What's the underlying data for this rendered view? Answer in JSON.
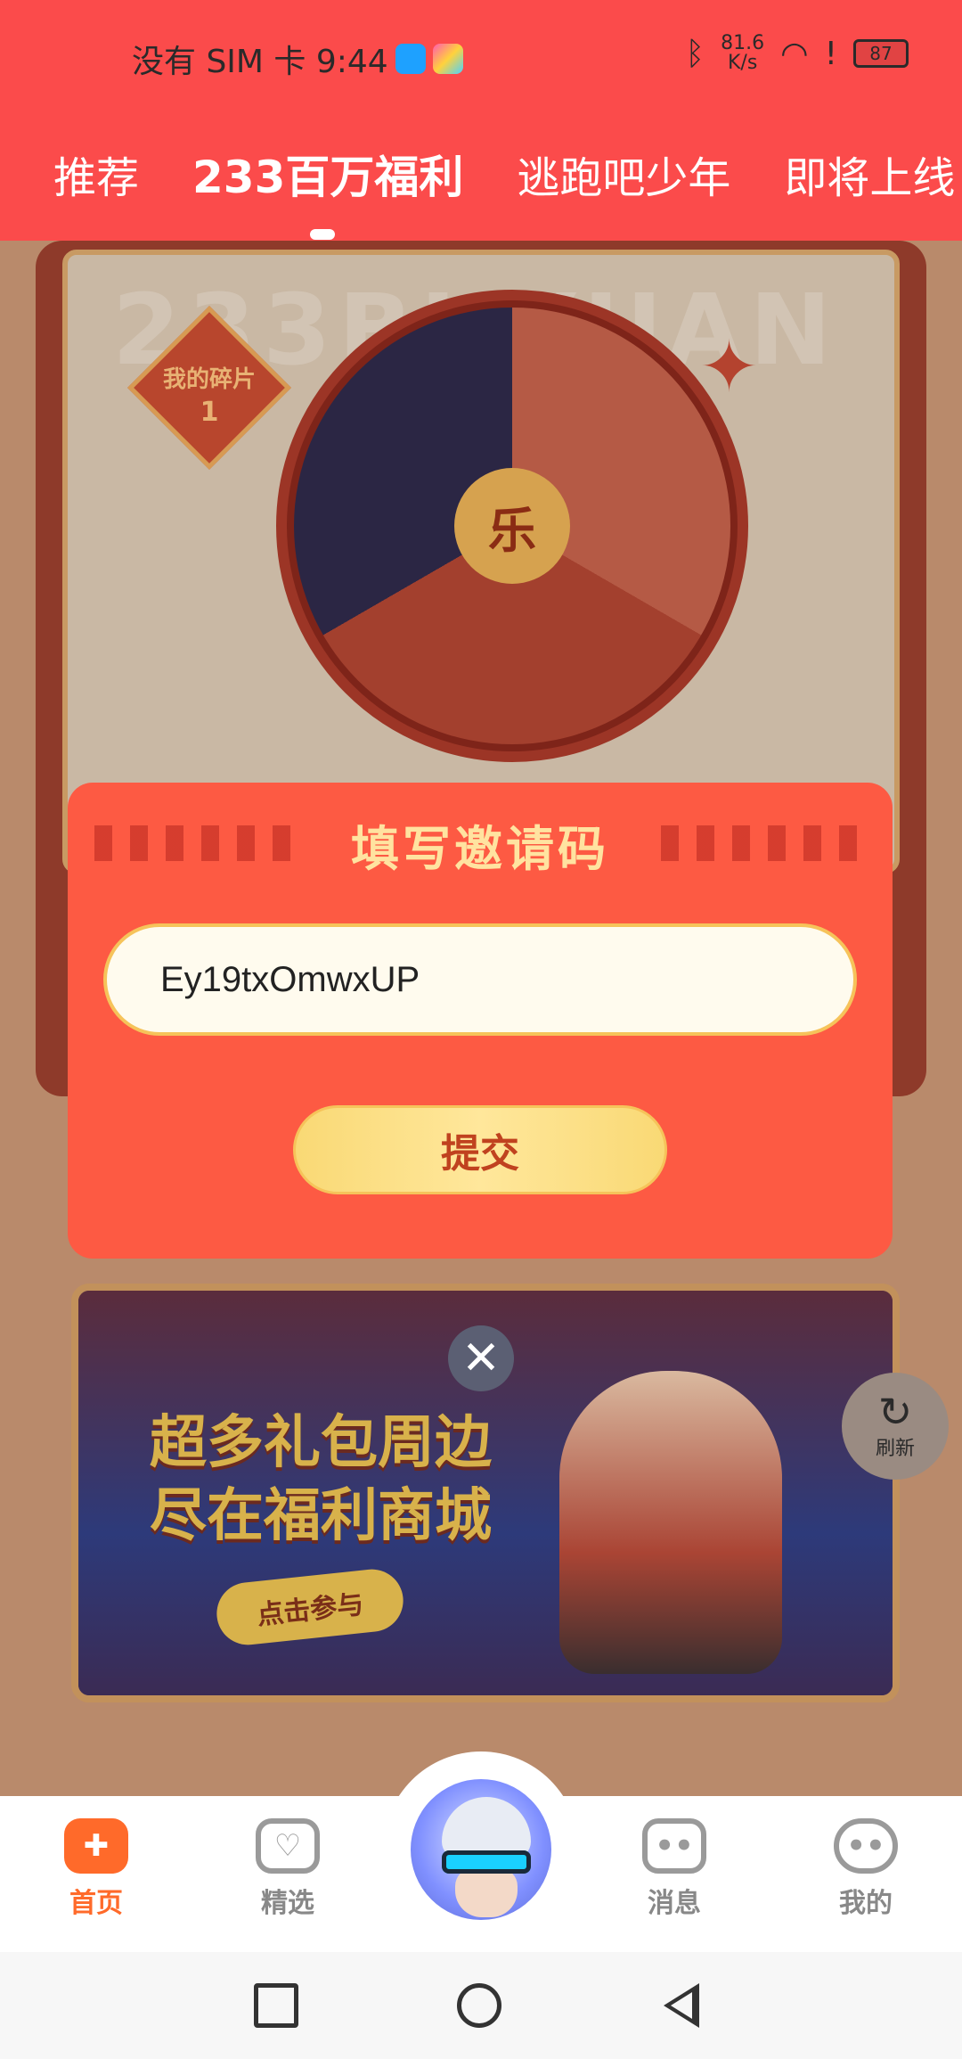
{
  "status_bar": {
    "carrier_time": "没有 SIM 卡 9:44",
    "net_speed_value": "81.6",
    "net_speed_unit": "K/s",
    "battery": "87",
    "icons": [
      "search-app-icon",
      "notify-app-icon",
      "bluetooth-icon",
      "wifi-icon",
      "alert-icon",
      "battery-icon"
    ]
  },
  "tabs": {
    "items": [
      {
        "label": "推荐"
      },
      {
        "label": "233百万福利"
      },
      {
        "label": "逃跑吧少年"
      },
      {
        "label": "即将上线"
      }
    ],
    "active_index": 1
  },
  "background": {
    "watermark": "233BI YUAN",
    "fragments_label": "我的碎片",
    "fragments_count": "1",
    "wheel_center": "乐",
    "promo_title_line1": "超多礼包周边",
    "promo_title_line2": "尽在福利商城",
    "promo_button": "点击参与",
    "refresh_label": "刷新"
  },
  "dialog": {
    "title": "填写邀请码",
    "invite_code": "Ey19txOmwxUP",
    "submit_label": "提交",
    "close_symbol": "✕"
  },
  "bottom_nav": {
    "items": [
      {
        "label": "首页",
        "icon": "gamepad-icon"
      },
      {
        "label": "精选",
        "icon": "heart-diamond-icon"
      },
      {
        "label": "消息",
        "icon": "chat-icon"
      },
      {
        "label": "我的",
        "icon": "smile-icon"
      }
    ]
  },
  "colors": {
    "header_red": "#fb4b4b",
    "dialog_red": "#fd5a43",
    "accent_orange": "#ff6a2a",
    "gold": "#f9d975"
  }
}
